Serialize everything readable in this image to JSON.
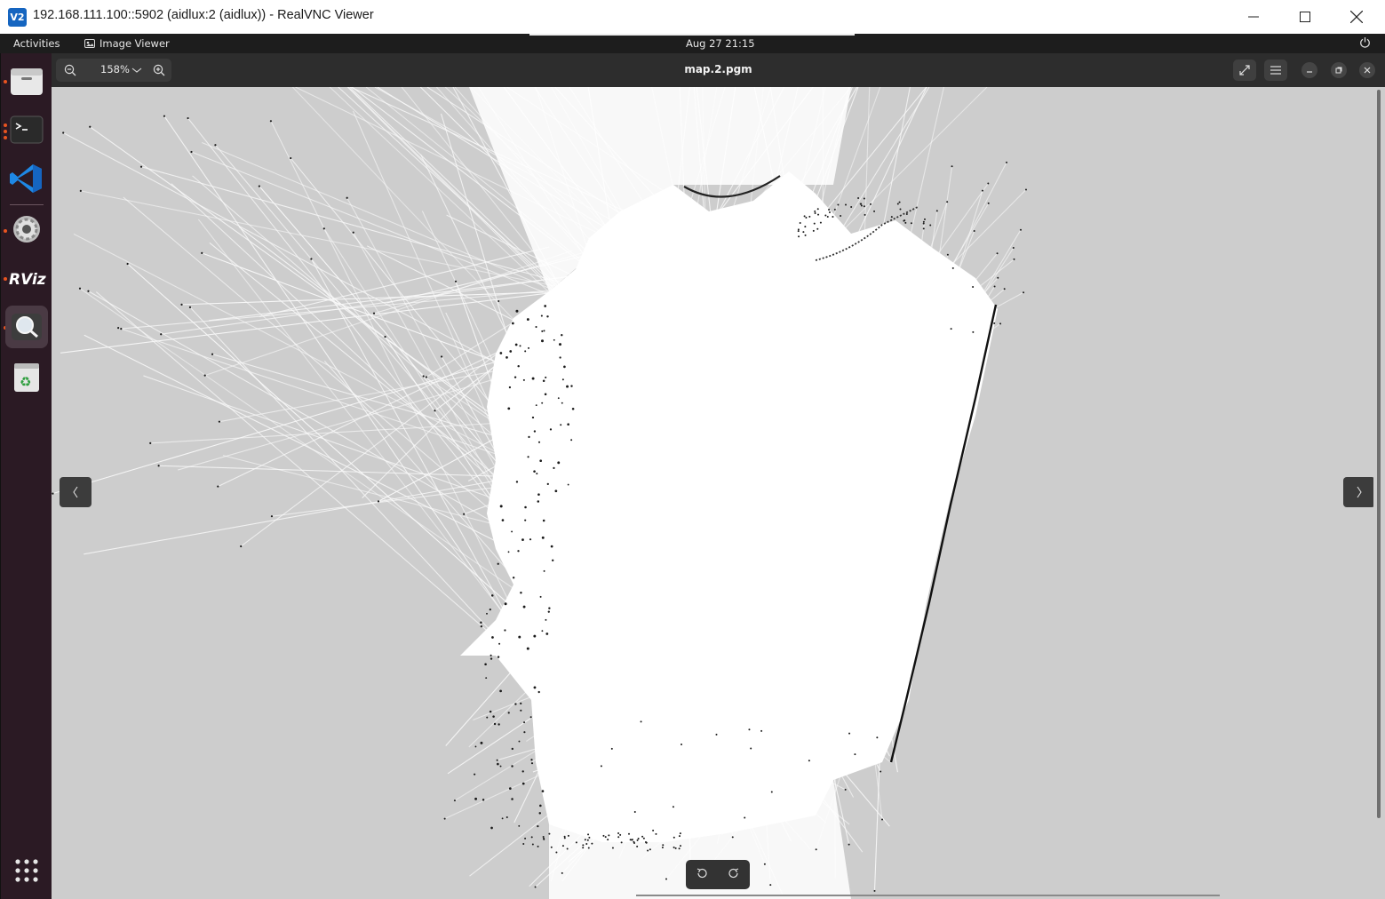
{
  "window": {
    "title": "192.168.111.100::5902 (aidlux:2 (aidlux)) - RealVNC Viewer",
    "app_icon_text": "V2"
  },
  "topbar": {
    "activities": "Activities",
    "app_name": "Image Viewer",
    "clock": "Aug 27  21:15"
  },
  "dock": {
    "items": [
      {
        "name": "files",
        "icon": "folder-icon",
        "running": true
      },
      {
        "name": "terminal",
        "icon": "terminal-icon",
        "running": true
      },
      {
        "name": "vscode",
        "icon": "vscode-icon",
        "running": false
      },
      {
        "name": "settings",
        "icon": "gear-icon",
        "running": true
      },
      {
        "name": "rviz",
        "icon": "rviz-icon",
        "label": "RViz",
        "running": true
      },
      {
        "name": "image-viewer",
        "icon": "magnifier-icon",
        "running": true,
        "active": true
      },
      {
        "name": "trash",
        "icon": "trash-icon",
        "running": false
      }
    ],
    "show_apps_icon": "grid-icon"
  },
  "viewer": {
    "zoom": "158%",
    "file_name": "map.2.pgm"
  },
  "colors": {
    "map_unknown": "#cdcdcd",
    "map_free": "#ffffff",
    "map_obstacle": "#111111",
    "ubuntu_accent": "#e95420"
  }
}
